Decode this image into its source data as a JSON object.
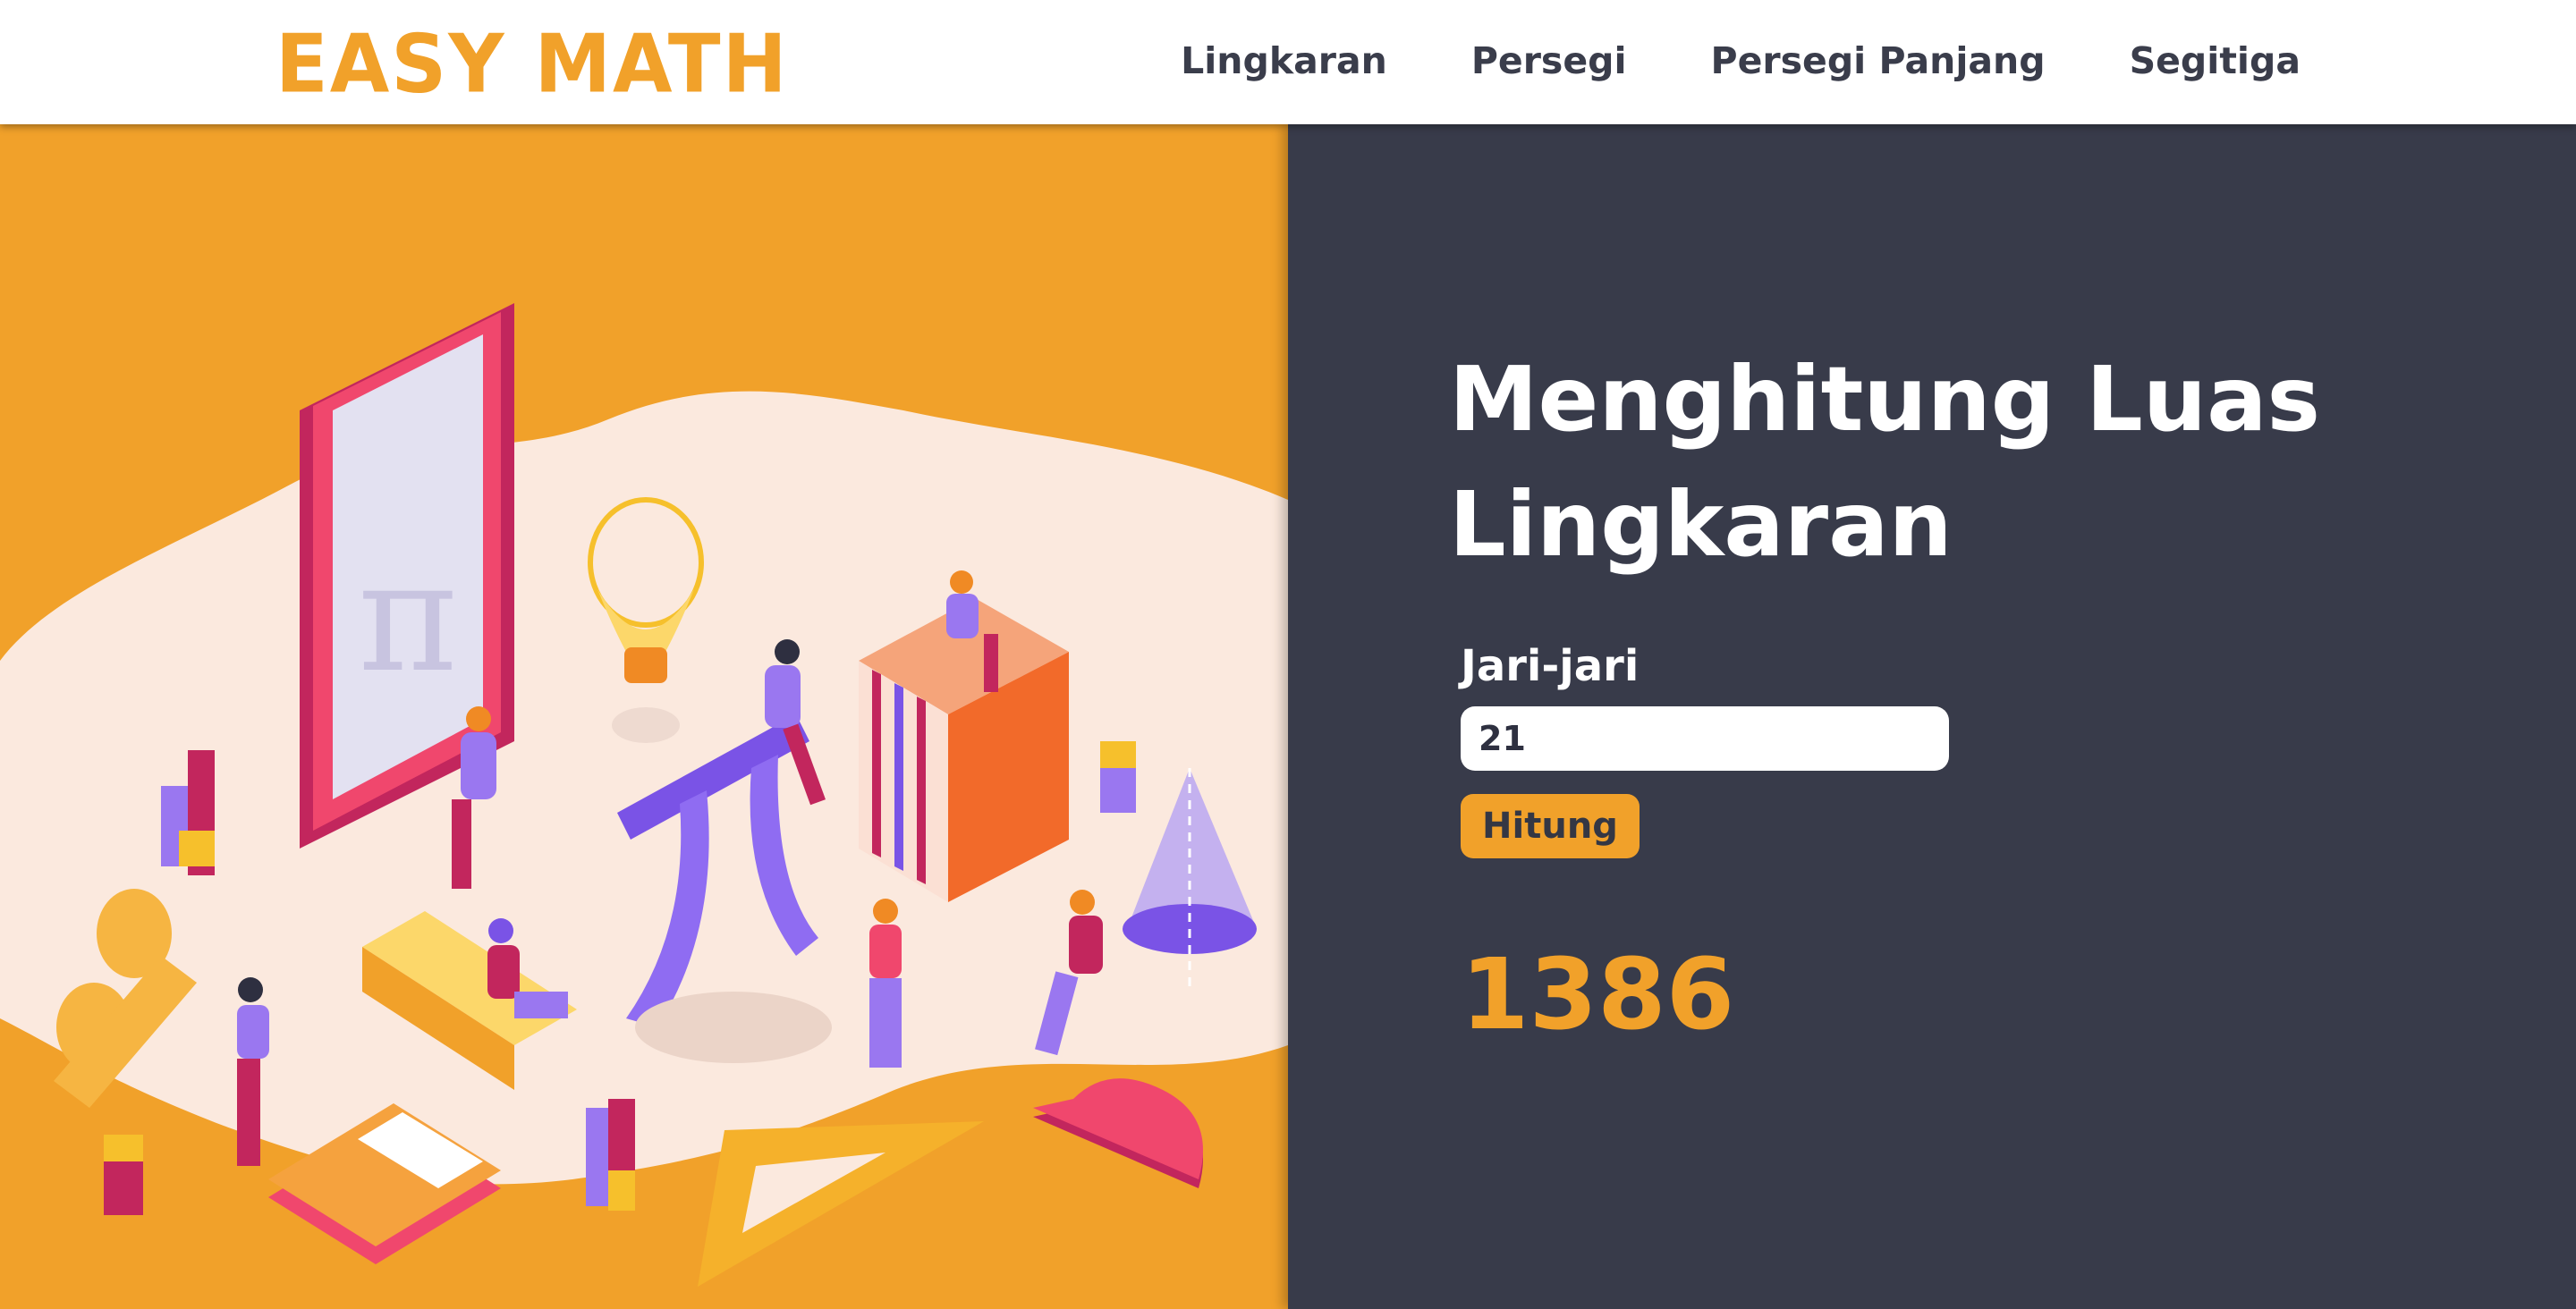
{
  "brand": {
    "logo_text": "EASY MATH",
    "accent": "#f1a12a"
  },
  "nav": {
    "items": [
      {
        "label": "Lingkaran"
      },
      {
        "label": "Persegi"
      },
      {
        "label": "Persegi Panjang"
      },
      {
        "label": "Segitiga"
      }
    ]
  },
  "calculator": {
    "title": "Menghitung Luas Lingkaran",
    "input_label": "Jari-jari",
    "input_value": "21",
    "button_label": "Hitung",
    "result": "1386"
  },
  "illustration": {
    "pi_symbol": "π"
  },
  "colors": {
    "dark_panel": "#383b4a",
    "text_dark": "#3a3d4b"
  }
}
